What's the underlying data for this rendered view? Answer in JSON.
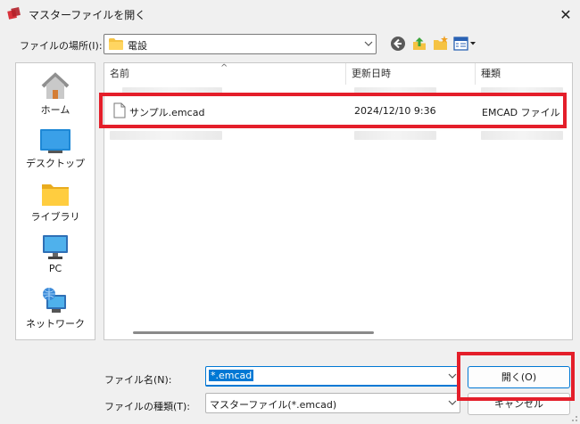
{
  "window": {
    "title": "マスターファイルを開く",
    "close_glyph": "✕"
  },
  "location": {
    "label": "ファイルの場所(I):",
    "value": "電設"
  },
  "sidebar": {
    "items": [
      {
        "label": "ホーム",
        "icon": "home-icon"
      },
      {
        "label": "デスクトップ",
        "icon": "desktop-icon"
      },
      {
        "label": "ライブラリ",
        "icon": "library-icon"
      },
      {
        "label": "PC",
        "icon": "pc-icon"
      },
      {
        "label": "ネットワーク",
        "icon": "network-icon"
      }
    ]
  },
  "file_list": {
    "columns": [
      "名前",
      "更新日時",
      "種類"
    ],
    "sort_glyph": "^",
    "rows": [
      {
        "name": "サンプル.emcad",
        "modified": "2024/12/10 9:36",
        "type": "EMCAD ファイル"
      }
    ]
  },
  "file_name": {
    "label": "ファイル名(N):",
    "value": "*.emcad"
  },
  "file_type": {
    "label": "ファイルの種類(T):",
    "value": "マスターファイル(*.emcad)"
  },
  "buttons": {
    "open": "開く(O)",
    "cancel": "キャンセル"
  },
  "colors": {
    "accent": "#0078d4",
    "highlight": "#e41e2a",
    "folder": "#f5c343"
  }
}
